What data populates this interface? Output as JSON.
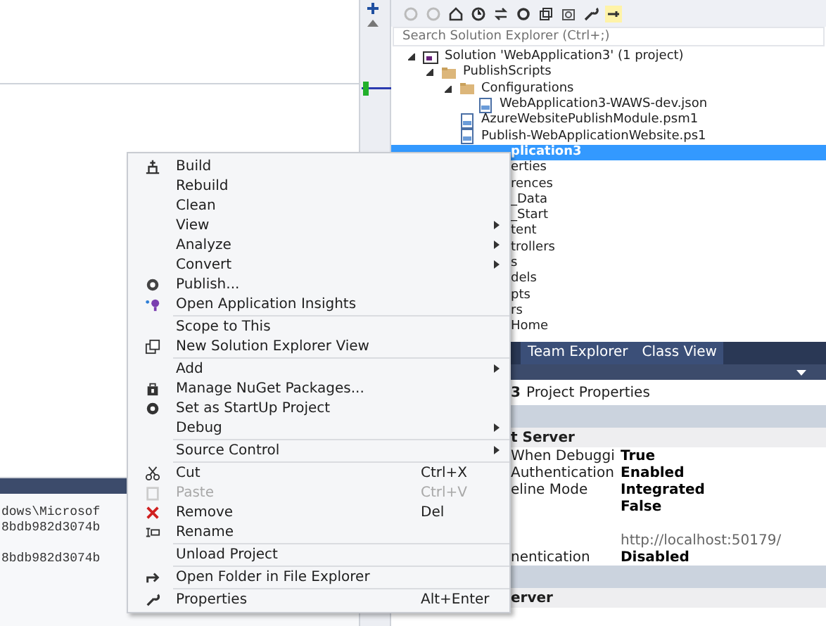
{
  "output_panel": {
    "lines": [
      {
        "text": "dows\\Microsof"
      },
      {
        "text": "8bdb982d3074b",
        "gap_after": true
      },
      {
        "text": "8bdb982d3074b"
      }
    ]
  },
  "solution_explorer": {
    "search": {
      "placeholder": "Search Solution Explorer (Ctrl+;)"
    },
    "tree": [
      {
        "label": "Solution 'WebApplication3' (1 project)",
        "selected": false,
        "expanded": true,
        "children": [
          {
            "label": "PublishScripts",
            "selected": false,
            "expanded": true,
            "children": [
              {
                "label": "Configurations",
                "selected": false,
                "expanded": true,
                "children": [
                  {
                    "label": "WebApplication3-WAWS-dev.json",
                    "selected": false
                  }
                ]
              },
              {
                "label": "AzureWebsitePublishModule.psm1",
                "selected": false
              },
              {
                "label": "Publish-WebApplicationWebsite.ps1",
                "selected": false
              }
            ]
          },
          {
            "label": "plication3",
            "selected": true,
            "kind": "partial",
            "children": [
              {
                "label": "erties",
                "selected": false,
                "kind": "partial"
              },
              {
                "label": "rences",
                "selected": false,
                "kind": "partial"
              },
              {
                "label": "_Data",
                "selected": false,
                "kind": "partial"
              },
              {
                "label": "_Start",
                "selected": false,
                "kind": "partial"
              },
              {
                "label": "tent",
                "selected": false,
                "kind": "partial"
              },
              {
                "label": "trollers",
                "selected": false,
                "kind": "partial"
              },
              {
                "label": "s",
                "selected": false,
                "kind": "partial"
              },
              {
                "label": "dels",
                "selected": false,
                "kind": "partial"
              },
              {
                "label": "pts",
                "selected": false,
                "kind": "partial"
              },
              {
                "label": "rs",
                "selected": false,
                "kind": "partial"
              },
              {
                "label": "Home",
                "selected": false,
                "kind": "partial"
              }
            ]
          }
        ]
      }
    ]
  },
  "tabs": [
    {
      "label": "Team Explorer",
      "selected": false
    },
    {
      "label": "Class View",
      "selected": false
    }
  ],
  "properties": {
    "title_bold": "3",
    "title": "Project Properties",
    "rows": [
      {
        "kind": "category",
        "name": ""
      },
      {
        "kind": "category",
        "name": "t Server"
      },
      {
        "kind": "property",
        "name": "When Debuggi",
        "value": "True",
        "bold": true
      },
      {
        "kind": "property",
        "name": "Authentication",
        "value": "Enabled",
        "bold": true
      },
      {
        "kind": "property",
        "name": "eline Mode",
        "value": "Integrated",
        "bold": true
      },
      {
        "kind": "property",
        "name": "",
        "value": "False",
        "bold": true,
        "gap_after": true
      },
      {
        "kind": "property",
        "name": "",
        "value": "http://localhost:50179/",
        "bold": false
      },
      {
        "kind": "property",
        "name": "nentication",
        "value": "Disabled",
        "bold": true
      },
      {
        "kind": "category",
        "name": ""
      },
      {
        "kind": "category",
        "name": "erver"
      }
    ]
  },
  "context_menu": [
    {
      "kind": "item",
      "label": "Build"
    },
    {
      "kind": "item",
      "label": "Rebuild"
    },
    {
      "kind": "item",
      "label": "Clean"
    },
    {
      "kind": "item",
      "label": "View",
      "submenu": true
    },
    {
      "kind": "item",
      "label": "Analyze",
      "submenu": true
    },
    {
      "kind": "item",
      "label": "Convert",
      "submenu": true
    },
    {
      "kind": "item",
      "label": "Publish..."
    },
    {
      "kind": "item",
      "label": "Open Application Insights"
    },
    {
      "kind": "separator"
    },
    {
      "kind": "item",
      "label": "Scope to This"
    },
    {
      "kind": "item",
      "label": "New Solution Explorer View"
    },
    {
      "kind": "separator"
    },
    {
      "kind": "item",
      "label": "Add",
      "submenu": true
    },
    {
      "kind": "item",
      "label": "Manage NuGet Packages..."
    },
    {
      "kind": "item",
      "label": "Set as StartUp Project"
    },
    {
      "kind": "item",
      "label": "Debug",
      "submenu": true
    },
    {
      "kind": "separator"
    },
    {
      "kind": "item",
      "label": "Source Control",
      "submenu": true
    },
    {
      "kind": "separator"
    },
    {
      "kind": "item",
      "label": "Cut",
      "shortcut": "Ctrl+X"
    },
    {
      "kind": "item",
      "label": "Paste",
      "shortcut": "Ctrl+V",
      "disabled": true
    },
    {
      "kind": "item",
      "label": "Remove",
      "shortcut": "Del"
    },
    {
      "kind": "item",
      "label": "Rename"
    },
    {
      "kind": "separator"
    },
    {
      "kind": "item",
      "label": "Unload Project"
    },
    {
      "kind": "separator"
    },
    {
      "kind": "item",
      "label": "Open Folder in File Explorer"
    },
    {
      "kind": "separator"
    },
    {
      "kind": "item",
      "label": "Properties",
      "shortcut": "Alt+Enter"
    }
  ]
}
